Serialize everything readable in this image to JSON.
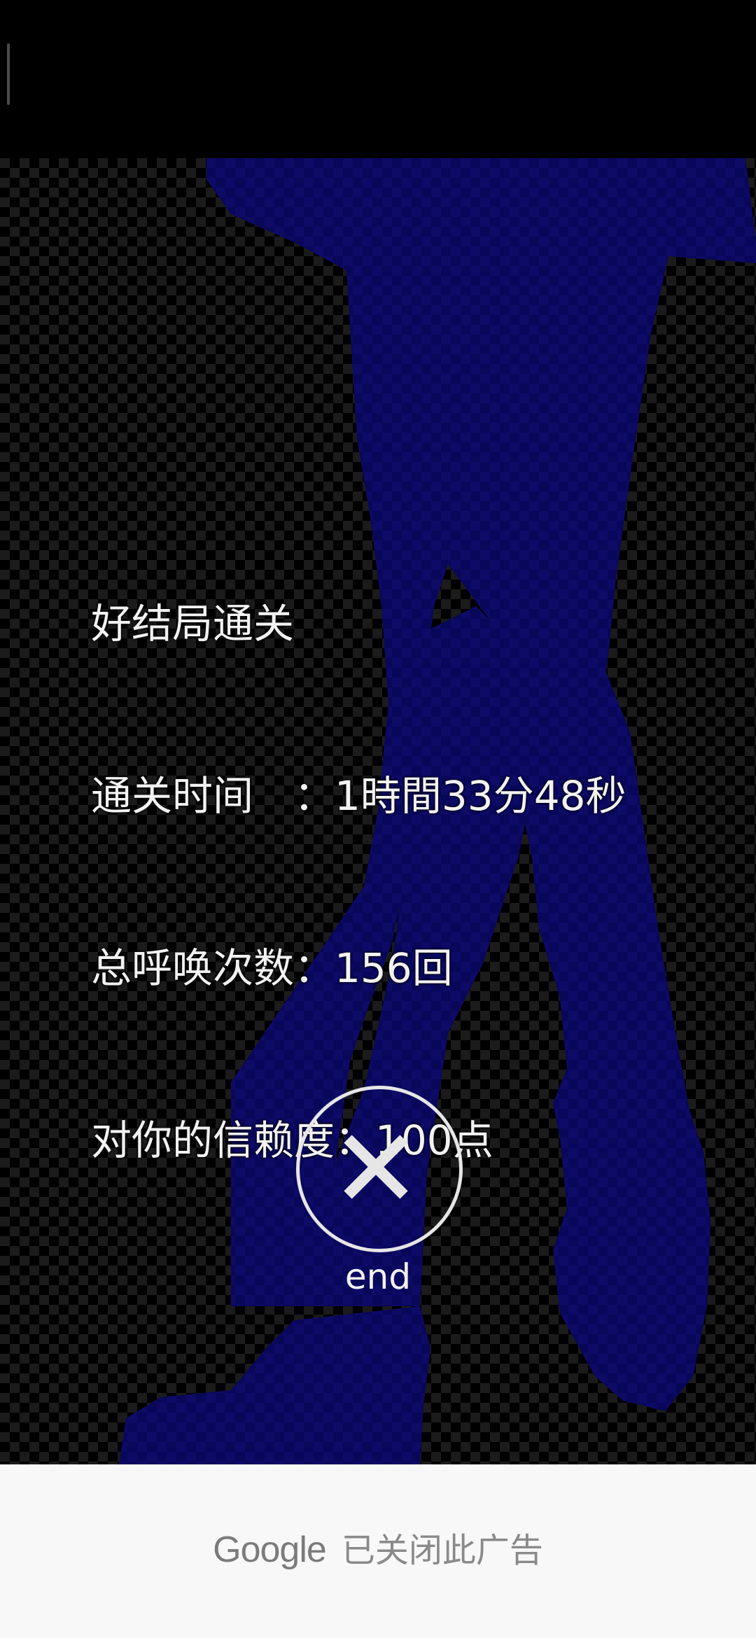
{
  "status_bar": {},
  "result": {
    "title": "好结局通关",
    "clear_time": "通关时间　：1時間33分48秒",
    "call_count": "总呼唤次数：156回",
    "trust": "对你的信赖度：100点"
  },
  "end_button": {
    "label": "end",
    "icon": "close-icon"
  },
  "ad": {
    "brand": "Google",
    "message": "已关闭此广告"
  },
  "colors": {
    "silhouette": "#0d0b66",
    "background_checker": "#1b1b1b",
    "text": "#f2f2f2",
    "ad_background": "#f8f8f8"
  }
}
